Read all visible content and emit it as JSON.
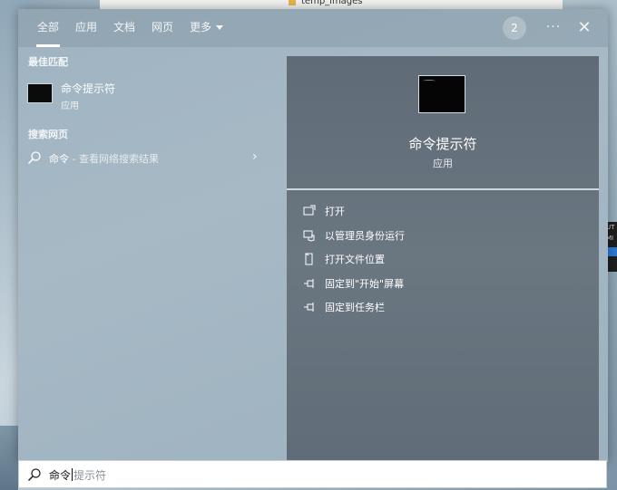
{
  "background": {
    "window_label": "temp_images"
  },
  "tabs": [
    {
      "label": "全部",
      "active": true
    },
    {
      "label": "应用",
      "active": false
    },
    {
      "label": "文档",
      "active": false
    },
    {
      "label": "网页",
      "active": false
    },
    {
      "label": "更多",
      "active": false
    }
  ],
  "header": {
    "counter": "2",
    "more_icon": "ellipsis-icon",
    "close_icon": "close-icon"
  },
  "best_match": {
    "section_title": "最佳匹配",
    "item": {
      "name": "命令提示符",
      "type": "应用"
    }
  },
  "web_search": {
    "section_title": "搜索网页",
    "query": "命令",
    "suffix": " - 查看网络搜索结果"
  },
  "preview": {
    "title": "命令提示符",
    "type": "应用",
    "actions": [
      {
        "label": "打开",
        "icon": "open-icon"
      },
      {
        "label": "以管理员身份运行",
        "icon": "run-as-admin-icon"
      },
      {
        "label": "打开文件位置",
        "icon": "file-location-icon"
      },
      {
        "label": "固定到\"开始\"屏幕",
        "icon": "pin-icon"
      },
      {
        "label": "固定到任务栏",
        "icon": "pin-icon"
      }
    ]
  },
  "search_box": {
    "typed": "命令",
    "suggestion": "提示符"
  },
  "colors": {
    "panel_bg": "#a3b6c3",
    "preview_bg": "#646f7a",
    "text": "#ffffff"
  }
}
